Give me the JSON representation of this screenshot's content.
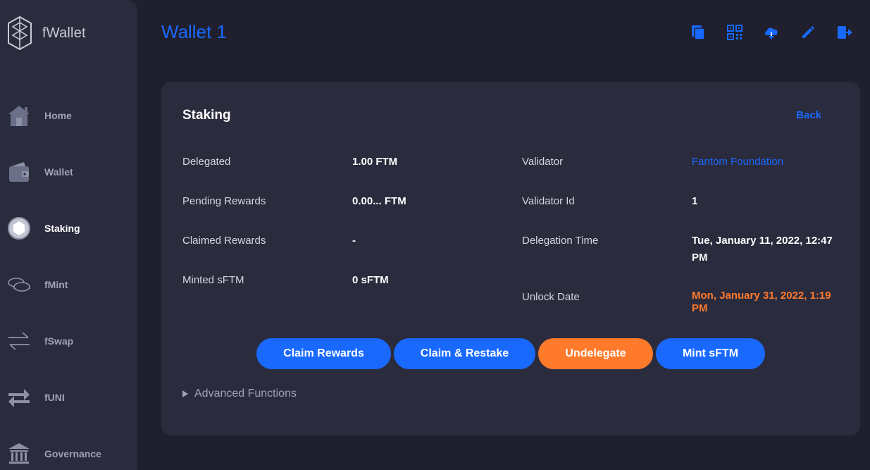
{
  "app": {
    "name": "fWallet"
  },
  "colors": {
    "accent": "#1969ff",
    "warning": "#ff7a2b",
    "sidebar": "#2b2b3e",
    "background": "#1f1f2e"
  },
  "sidebar": {
    "items": [
      {
        "label": "Home",
        "icon": "home-icon"
      },
      {
        "label": "Wallet",
        "icon": "wallet-icon"
      },
      {
        "label": "Staking",
        "icon": "staking-icon",
        "active": true
      },
      {
        "label": "fMint",
        "icon": "coins-icon"
      },
      {
        "label": "fSwap",
        "icon": "swap-arrows-icon"
      },
      {
        "label": "fUNI",
        "icon": "transfer-arrows-icon"
      },
      {
        "label": "Governance",
        "icon": "bank-icon"
      }
    ]
  },
  "header": {
    "title": "Wallet 1",
    "actions": [
      "copy-icon",
      "qr-code-icon",
      "cloud-download-icon",
      "edit-icon",
      "logout-icon"
    ]
  },
  "staking": {
    "title": "Staking",
    "back_label": "Back",
    "left": [
      {
        "label": "Delegated",
        "value": "1.00 FTM"
      },
      {
        "label": "Pending Rewards",
        "value": "0.00... FTM"
      },
      {
        "label": "Claimed Rewards",
        "value": "-"
      },
      {
        "label": "Minted sFTM",
        "value": "0 sFTM"
      }
    ],
    "right": [
      {
        "label": "Validator",
        "value": "Fantom Foundation"
      },
      {
        "label": "Validator Id",
        "value": "1"
      },
      {
        "label": "Delegation Time",
        "value": "Tue, January 11, 2022, 12:47 PM"
      },
      {
        "label": "Unlock Date",
        "value": "Mon, January 31, 2022, 1:19 PM"
      }
    ],
    "buttons": {
      "claim_rewards": "Claim Rewards",
      "claim_restake": "Claim & Restake",
      "undelegate": "Undelegate",
      "mint_sftm": "Mint sFTM"
    },
    "advanced_label": "Advanced Functions"
  }
}
